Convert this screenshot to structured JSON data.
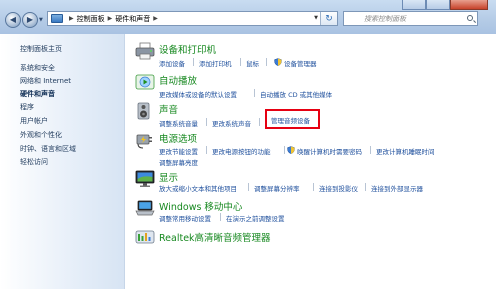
{
  "window": {
    "nav": {
      "back_icon": "back-arrow-icon",
      "forward_icon": "forward-arrow-icon"
    },
    "address": {
      "crumbs": [
        "控制面板",
        "硬件和声音"
      ],
      "folder_icon": "control-panel-icon"
    },
    "search": {
      "placeholder": "搜索控制面板"
    }
  },
  "sidebar": {
    "items": [
      {
        "label": "控制面板主页",
        "active": false
      },
      {
        "label": "系统和安全",
        "active": false
      },
      {
        "label": "网络和 Internet",
        "active": false
      },
      {
        "label": "硬件和声音",
        "active": true
      },
      {
        "label": "程序",
        "active": false
      },
      {
        "label": "用户帐户",
        "active": false
      },
      {
        "label": "外观和个性化",
        "active": false
      },
      {
        "label": "时钟、语言和区域",
        "active": false
      },
      {
        "label": "轻松访问",
        "active": false
      }
    ]
  },
  "categories": {
    "devices": {
      "title": "设备和打印机",
      "icon": "printer-icon",
      "links": [
        "添加设备",
        "添加打印机",
        "鼠标",
        "设备管理器"
      ]
    },
    "autoplay": {
      "title": "自动播放",
      "icon": "autoplay-icon",
      "links": [
        "更改媒体或设备的默认设置",
        "自动播放 CD 或其他媒体"
      ]
    },
    "sound": {
      "title": "声音",
      "icon": "speaker-icon",
      "links": [
        "调整系统音量",
        "更改系统声音",
        "管理音频设备"
      ]
    },
    "power": {
      "title": "电源选项",
      "icon": "power-plug-icon",
      "links": [
        "更改节能设置",
        "更改电源按钮的功能",
        "唤醒计算机时需要密码",
        "更改计算机睡眠时间",
        "调整屏幕亮度"
      ]
    },
    "display": {
      "title": "显示",
      "icon": "monitor-icon",
      "links": [
        "放大或缩小文本和其他项目",
        "调整屏幕分辨率",
        "连接到投影仪",
        "连接到外部显示器"
      ]
    },
    "mobility": {
      "title": "Windows 移动中心",
      "icon": "mobility-center-icon",
      "links": [
        "调整常用移动设置",
        "在演示之前调整设置"
      ]
    },
    "realtek": {
      "title": "Realtek高清晰音频管理器",
      "icon": "realtek-audio-icon"
    }
  },
  "colors": {
    "category_title": "#16881f",
    "link": "#1e4f9c",
    "highlight": "#e60012"
  }
}
